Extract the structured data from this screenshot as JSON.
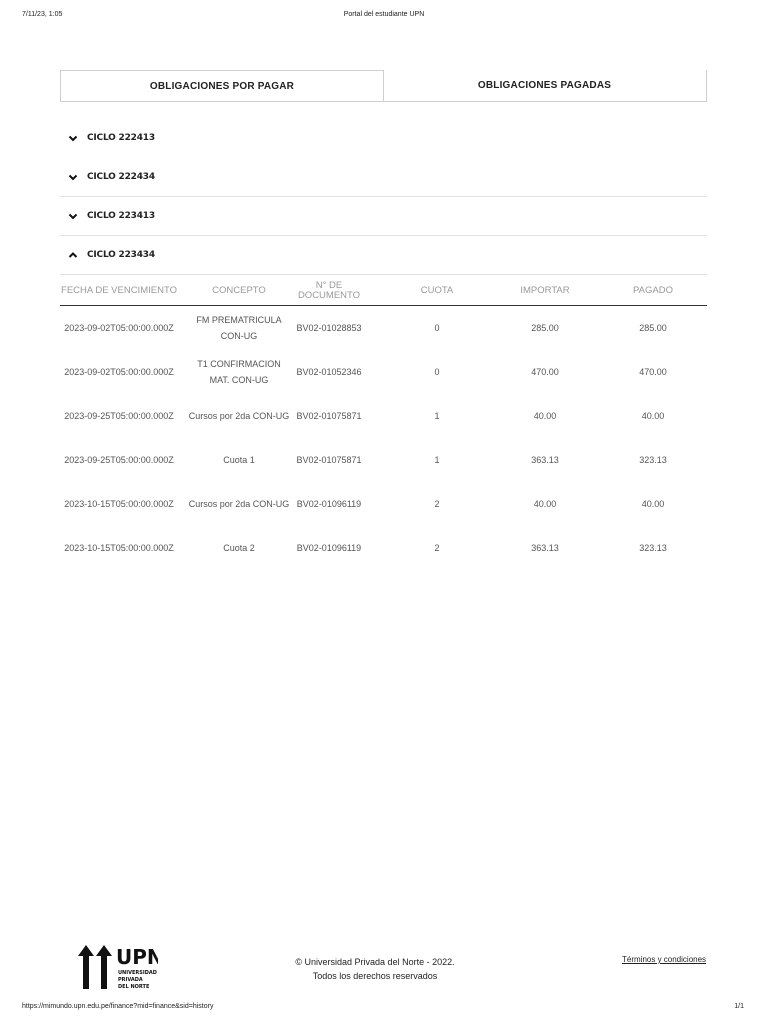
{
  "print_header": {
    "date": "7/11/23, 1:05",
    "title": "Portal del estudiante UPN"
  },
  "tabs": [
    {
      "label": "OBLIGACIONES POR PAGAR"
    },
    {
      "label": "OBLIGACIONES PAGADAS"
    }
  ],
  "cycles": [
    {
      "label": "CICLO 222413",
      "state": "collapsed",
      "icon": "chevron-down-icon"
    },
    {
      "label": "CICLO 222434",
      "state": "collapsed",
      "icon": "chevron-down-icon"
    },
    {
      "label": "CICLO 223413",
      "state": "collapsed",
      "icon": "chevron-down-icon"
    },
    {
      "label": "CICLO 223434",
      "state": "expanded",
      "icon": "chevron-up-icon"
    }
  ],
  "table": {
    "headers": [
      "FECHA DE VENCIMIENTO",
      "CONCEPTO",
      "N° DE DOCUMENTO",
      "CUOTA",
      "IMPORTAR",
      "PAGADO"
    ],
    "rows": [
      {
        "fecha": "2023-09-02T05:00:00.000Z",
        "concepto": "FM PREMATRICULA CON-UG",
        "documento": "BV02-01028853",
        "cuota": "0",
        "importar": "285.00",
        "pagado": "285.00"
      },
      {
        "fecha": "2023-09-02T05:00:00.000Z",
        "concepto": "T1 CONFIRMACION MAT. CON-UG",
        "documento": "BV02-01052346",
        "cuota": "0",
        "importar": "470.00",
        "pagado": "470.00"
      },
      {
        "fecha": "2023-09-25T05:00:00.000Z",
        "concepto": "Cursos por 2da CON-UG",
        "documento": "BV02-01075871",
        "cuota": "1",
        "importar": "40.00",
        "pagado": "40.00"
      },
      {
        "fecha": "2023-09-25T05:00:00.000Z",
        "concepto": "Cuota 1",
        "documento": "BV02-01075871",
        "cuota": "1",
        "importar": "363.13",
        "pagado": "323.13"
      },
      {
        "fecha": "2023-10-15T05:00:00.000Z",
        "concepto": "Cursos por 2da CON-UG",
        "documento": "BV02-01096119",
        "cuota": "2",
        "importar": "40.00",
        "pagado": "40.00"
      },
      {
        "fecha": "2023-10-15T05:00:00.000Z",
        "concepto": "Cuota 2",
        "documento": "BV02-01096119",
        "cuota": "2",
        "importar": "363.13",
        "pagado": "323.13"
      }
    ]
  },
  "footer": {
    "logo_text": "UPN",
    "logo_subtext": [
      "UNIVERSIDAD",
      "PRIVADA",
      "DEL NORTE"
    ],
    "copyright_line1": "© Universidad Privada del Norte - 2022.",
    "copyright_line2": "Todos los derechos reservados",
    "terms_link": "Términos y condiciones"
  },
  "print_footer": {
    "url": "https://mimundo.upn.edu.pe/finance?mid=finance&sid=history",
    "pages": "1/1"
  }
}
